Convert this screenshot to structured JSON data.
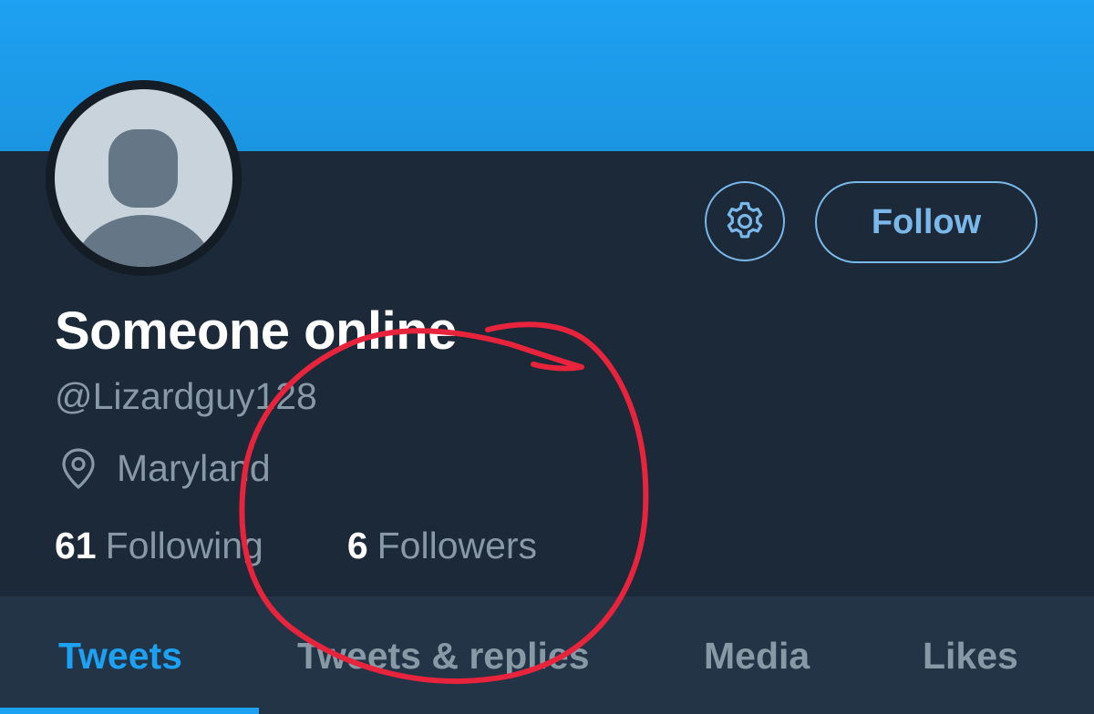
{
  "profile": {
    "display_name": "Someone online",
    "handle": "@Lizardguy128",
    "location": "Maryland"
  },
  "actions": {
    "settings_icon": "gear-icon",
    "follow_label": "Follow"
  },
  "stats": {
    "following_count": "61",
    "following_label": "Following",
    "followers_count": "6",
    "followers_label": "Followers"
  },
  "tabs": [
    {
      "label": "Tweets",
      "active": true
    },
    {
      "label": "Tweets & replies",
      "active": false
    },
    {
      "label": "Media",
      "active": false
    },
    {
      "label": "Likes",
      "active": false
    }
  ],
  "colors": {
    "banner": "#1da1f2",
    "background": "#1c2938",
    "tabbar": "#243447",
    "accent": "#7ab8ea",
    "annotation": "#e8243c"
  }
}
